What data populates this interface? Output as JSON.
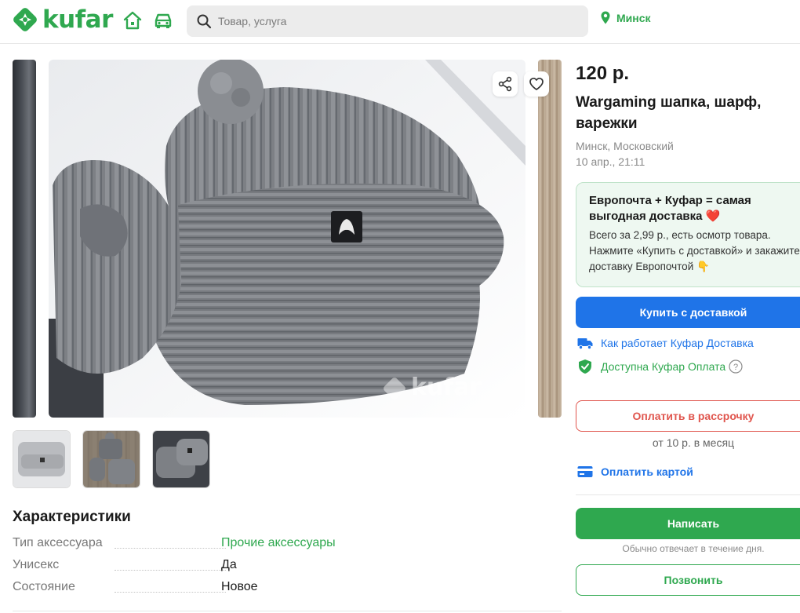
{
  "header": {
    "logo_text": "kufar",
    "search": {
      "placeholder": "Товар, услуга",
      "value": ""
    },
    "location": "Минск",
    "brand_color": "#2fa84f"
  },
  "gallery": {
    "watermark": "kufar",
    "thumbnails_count": 3,
    "icons": [
      "share-icon",
      "heart-icon"
    ]
  },
  "listing": {
    "price": "120 р.",
    "title": "Wargaming шапка, шарф, варежки",
    "location": "Минск, Московский",
    "date": "10 апр., 21:11"
  },
  "promo": {
    "title": "Европочта + Куфар = самая выгодная доставка ❤️",
    "text": "Всего за 2,99 р., есть осмотр товара. Нажмите «Купить с доставкой» и закажите доставку Европочтой 👇"
  },
  "actions": {
    "buy_delivery": "Купить с доставкой",
    "how_delivery_works": "Как работает Куфар Доставка",
    "payment_available": "Доступна Куфар Оплата",
    "installment": "Оплатить в рассрочку",
    "installment_sub": "от 10 р. в месяц",
    "pay_card": "Оплатить картой",
    "write": "Написать",
    "reply_note": "Обычно отвечает в течение дня.",
    "call": "Позвонить"
  },
  "characteristics": {
    "title": "Характеристики",
    "rows": [
      {
        "key": "Тип аксессуара",
        "value": "Прочие аксессуары"
      },
      {
        "key": "Унисекс",
        "value": "Да"
      },
      {
        "key": "Состояние",
        "value": "Новое"
      }
    ]
  }
}
